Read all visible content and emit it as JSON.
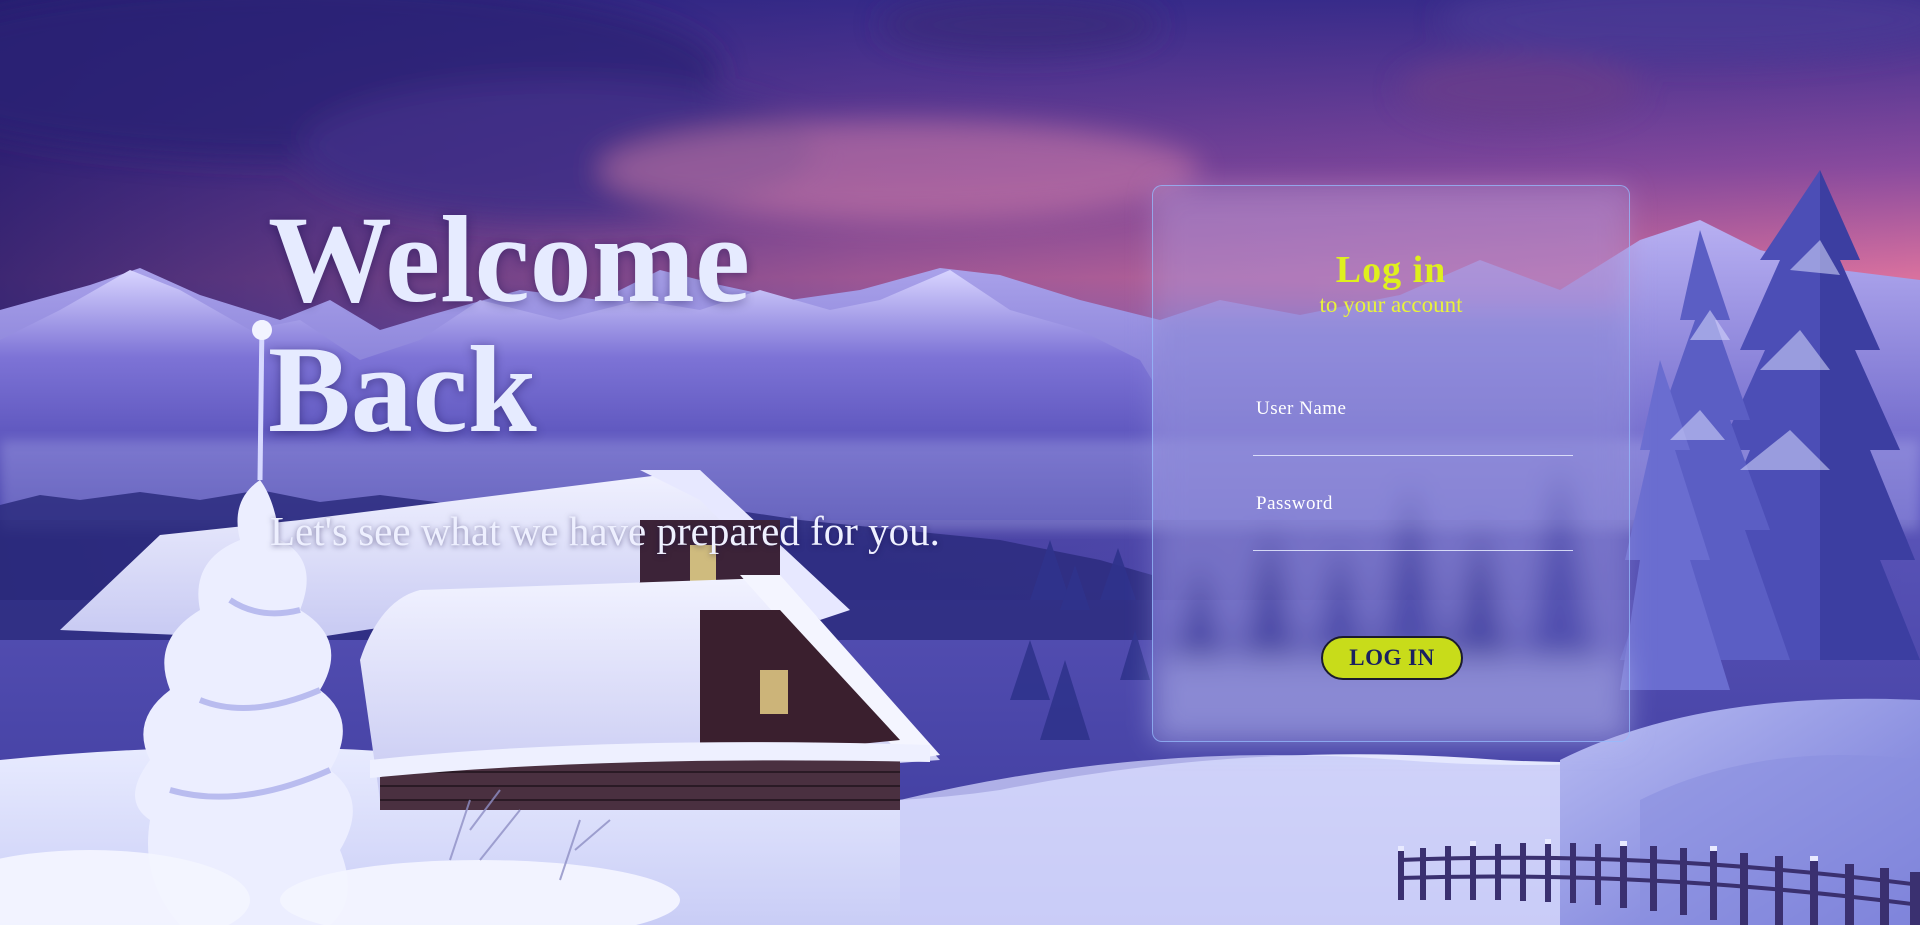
{
  "hero": {
    "title_line1": "Welcome",
    "title_line2": "Back",
    "subtitle": "Let's see what we have prepared for you."
  },
  "login": {
    "heading": "Log in",
    "subheading": "to your account",
    "username_label": "User Name",
    "username_value": "",
    "password_label": "Password",
    "password_value": "",
    "button_label": "LOG IN"
  },
  "colors": {
    "accent": "#dff01d",
    "button_fill": "#c8dc1a",
    "button_text": "#1a2160",
    "title_text": "#e6ebff",
    "card_border": "#96beff"
  }
}
